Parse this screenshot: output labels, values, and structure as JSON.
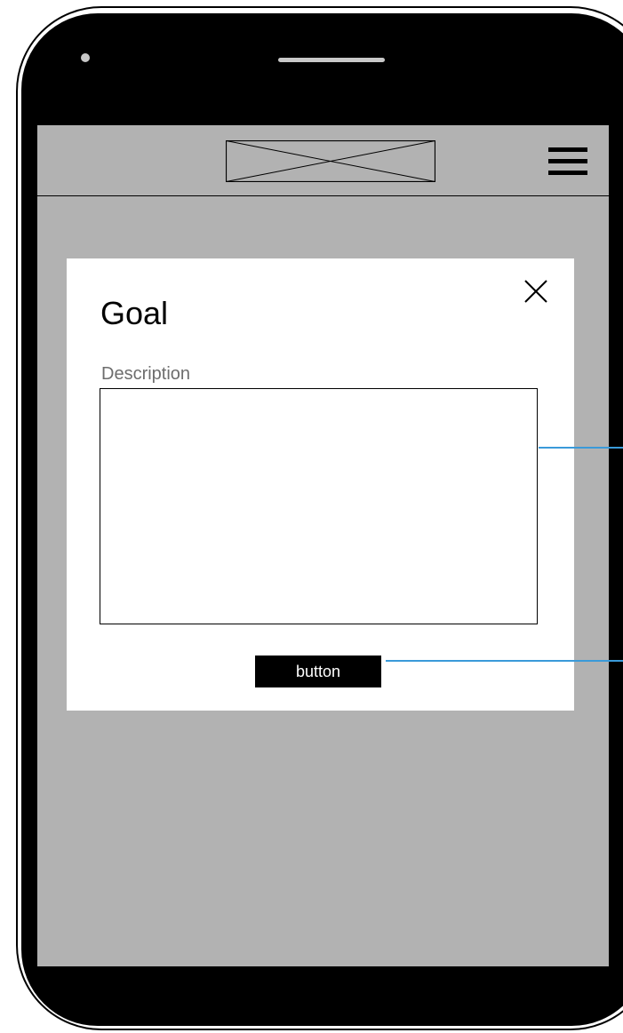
{
  "modal": {
    "title": "Goal",
    "description_label": "Description",
    "description_value": "",
    "button_label": "button"
  },
  "icons": {
    "logo": "image-placeholder-icon",
    "menu": "hamburger-menu-icon",
    "close": "close-icon"
  },
  "colors": {
    "screen_background": "#b2b2b2",
    "device_frame": "#000000",
    "annotation_line": "#3a9ad9",
    "label_text": "#6d6d6d"
  }
}
